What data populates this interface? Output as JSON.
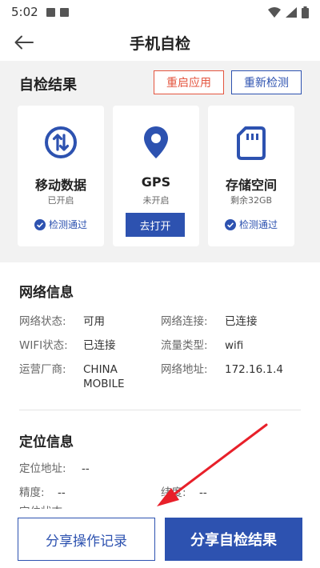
{
  "status_bar": {
    "time": "5:02"
  },
  "header": {
    "title": "手机自检"
  },
  "check": {
    "title": "自检结果",
    "restart_label": "重启应用",
    "recheck_label": "重新检测",
    "cards": [
      {
        "name": "移动数据",
        "status": "已开启",
        "result": "检测通过",
        "icon": "mobile-data-icon"
      },
      {
        "name": "GPS",
        "status": "未开启",
        "action": "去打开",
        "icon": "location-pin-icon"
      },
      {
        "name": "存储空间",
        "status": "剩余32GB",
        "result": "检测通过",
        "icon": "sd-card-icon"
      }
    ]
  },
  "network": {
    "title": "网络信息",
    "rows": [
      {
        "label": "网络状态:",
        "value": "可用"
      },
      {
        "label": "网络连接:",
        "value": "已连接"
      },
      {
        "label": "WIFI状态:",
        "value": "已连接"
      },
      {
        "label": "流量类型:",
        "value": "wifi"
      },
      {
        "label": "运营厂商:",
        "value": "CHINA\nMOBILE"
      },
      {
        "label": "网络地址:",
        "value": "172.16.1.4"
      }
    ]
  },
  "location": {
    "title": "定位信息",
    "rows": [
      {
        "label": "定位地址:",
        "value": "--"
      },
      {
        "label": "精度:",
        "value": "--"
      },
      {
        "label": "纬度:",
        "value": "--"
      },
      {
        "label": "定位状态:",
        "value": ""
      }
    ]
  },
  "bottom": {
    "share_log_label": "分享操作记录",
    "share_result_label": "分享自检结果"
  },
  "colors": {
    "primary": "#2d52b0",
    "danger": "#e4553f",
    "panel_bg": "#f2f2f2",
    "arrow": "#e8202a"
  }
}
